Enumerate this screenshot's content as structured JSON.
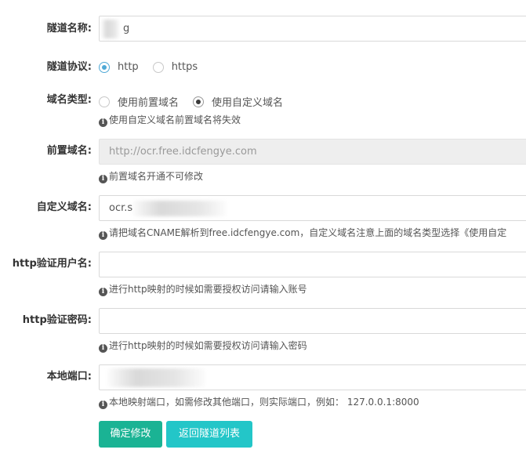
{
  "form": {
    "tunnel_name": {
      "label": "隧道名称:",
      "value": "g"
    },
    "protocol": {
      "label": "隧道协议:",
      "options": [
        {
          "label": "http",
          "checked": true
        },
        {
          "label": "https",
          "checked": false
        }
      ]
    },
    "domain_type": {
      "label": "域名类型:",
      "options": [
        {
          "label": "使用前置域名",
          "checked": false
        },
        {
          "label": "使用自定义域名",
          "checked": true
        }
      ],
      "help": "使用自定义域名前置域名将失效"
    },
    "front_domain": {
      "label": "前置域名:",
      "value": "http://ocr.free.idcfengye.com",
      "help": "前置域名开通不可修改"
    },
    "custom_domain": {
      "label": "自定义域名:",
      "value": "ocr.s",
      "help": "请把域名CNAME解析到free.idcfengye.com，自定义域名注意上面的域名类型选择《使用自定"
    },
    "http_user": {
      "label": "http验证用户名:",
      "value": "",
      "help": "进行http映射的时候如需要授权访问请输入账号"
    },
    "http_password": {
      "label": "http验证密码:",
      "value": "",
      "help": "进行http映射的时候如需要授权访问请输入密码"
    },
    "local_port": {
      "label": "本地端口:",
      "value": "",
      "help": "本地映射端口，如需修改其他端口，则实际端口，例如： 127.0.0.1:8000"
    }
  },
  "buttons": {
    "confirm": "确定修改",
    "back": "返回隧道列表"
  },
  "colors": {
    "primary": "#1ab394",
    "secondary": "#23c6c8",
    "radio_checked": "#4fa9d6"
  },
  "icons": {
    "help": "info-circle-icon"
  }
}
